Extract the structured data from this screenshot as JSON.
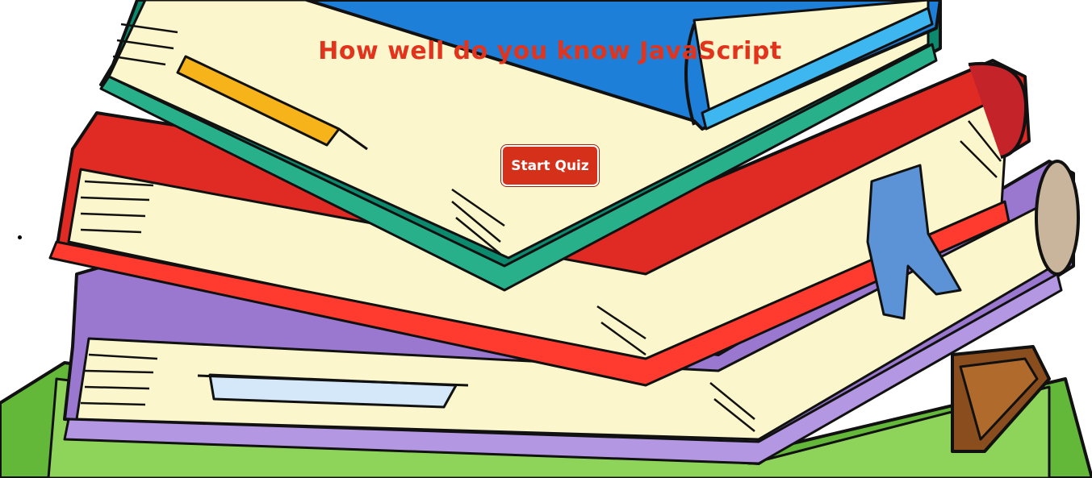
{
  "page": {
    "title": "How well do you know JavaScript",
    "start_button_label": "Start Quiz"
  },
  "colors": {
    "title": "#e2341c",
    "button_bg": "#d4301a",
    "button_text": "#ffffff",
    "book_blue": "#1e7fd8",
    "book_teal": "#0b8a6e",
    "book_red": "#e02a24",
    "book_purple": "#9a78d0",
    "book_green": "#63b83a",
    "book_brown": "#8a4d1e",
    "page_cream": "#fbf6cc"
  },
  "background": {
    "illustration": "stack-of-books-icon"
  }
}
